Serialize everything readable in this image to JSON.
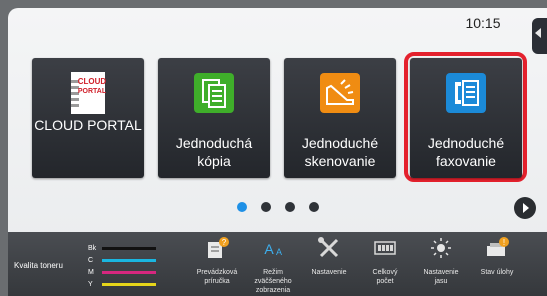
{
  "clock": "10:15",
  "tiles": [
    {
      "label": "CLOUD PORTAL",
      "logo_text_1": "CLOUD",
      "logo_text_2": "PORTAL"
    },
    {
      "label_1": "Jednoduchá",
      "label_2": "kópia"
    },
    {
      "label_1": "Jednoduché",
      "label_2": "skenovanie"
    },
    {
      "label_1": "Jednoduché",
      "label_2": "faxovanie",
      "highlighted": true
    }
  ],
  "pagination": {
    "pages": 4,
    "current": 1
  },
  "toner": {
    "label": "Kvalita toneru",
    "rows": [
      {
        "name": "Bk",
        "color": "#111111"
      },
      {
        "name": "C",
        "color": "#1ab6e0"
      },
      {
        "name": "M",
        "color": "#d6277f"
      },
      {
        "name": "Y",
        "color": "#e6d51a"
      }
    ]
  },
  "bottom_items": [
    {
      "label_1": "Prevádzková",
      "label_2": "príručka",
      "icon": "manual-icon"
    },
    {
      "label_1": "Režim",
      "label_2": "zväčšeného",
      "label_3": "zobrazenia",
      "icon": "enlarge-icon"
    },
    {
      "label_1": "Nastavenie",
      "icon": "settings-icon"
    },
    {
      "label_1": "Celkový",
      "label_2": "počet",
      "icon": "counter-icon"
    },
    {
      "label_1": "Nastavenie",
      "label_2": "jasu",
      "icon": "brightness-icon"
    },
    {
      "label_1": "Stav úlohy",
      "icon": "job-status-icon"
    }
  ],
  "colors": {
    "highlight": "#e4212d",
    "active_dot": "#1e90e6"
  }
}
